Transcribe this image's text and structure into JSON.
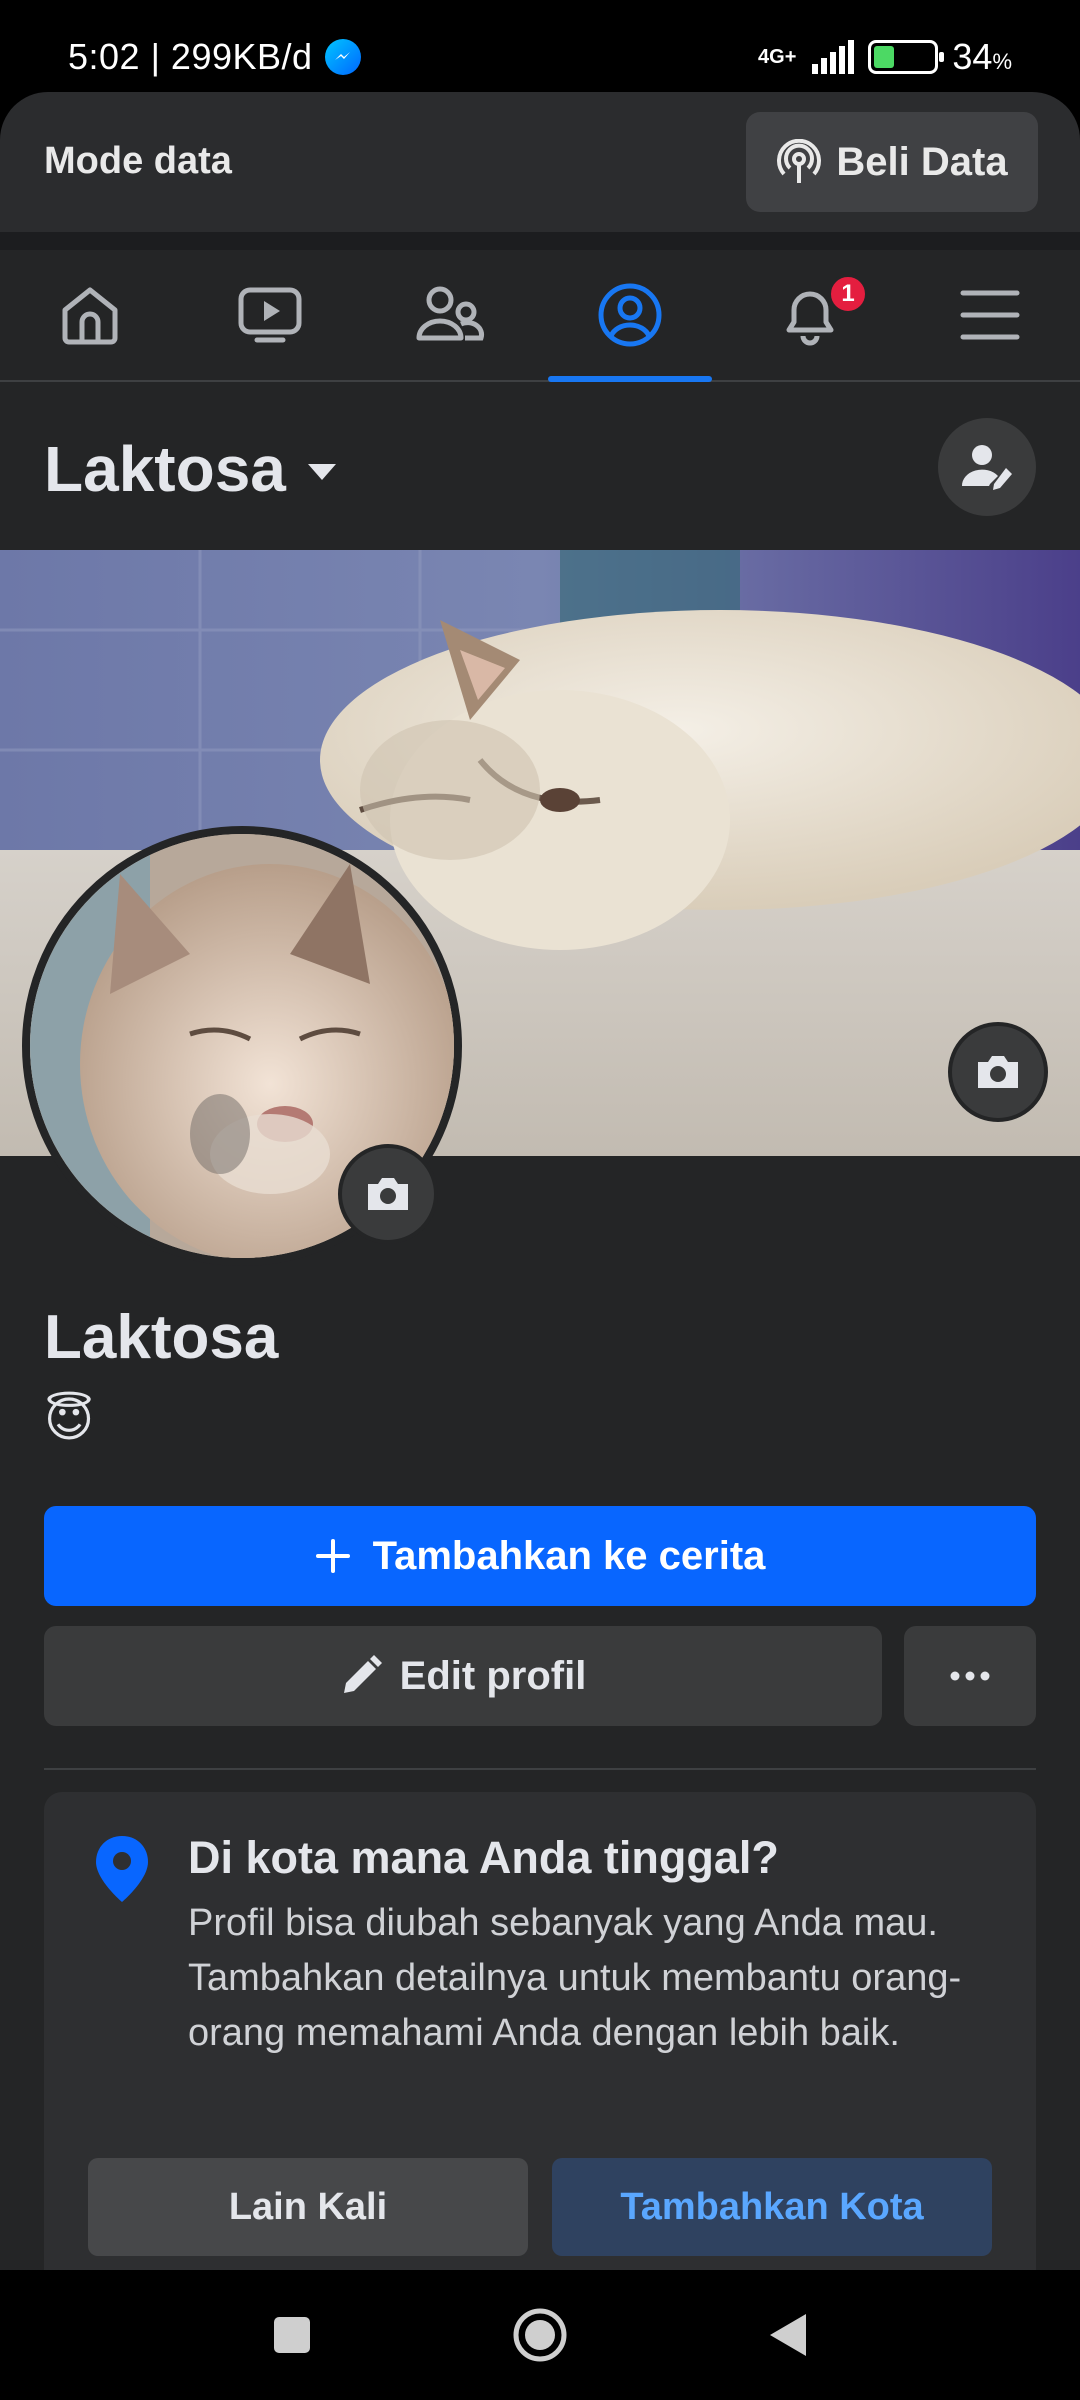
{
  "status_bar": {
    "time_speed": "5:02 | 299KB/d",
    "network": "4G+",
    "battery": "34",
    "battery_unit": "%",
    "battery_level": 0.34
  },
  "mode_bar": {
    "label": "Mode data",
    "buy_button": "Beli Data"
  },
  "nav": {
    "items": [
      {
        "icon": "home-icon"
      },
      {
        "icon": "video-icon"
      },
      {
        "icon": "friends-icon"
      },
      {
        "icon": "profile-icon",
        "active": true
      },
      {
        "icon": "bell-icon",
        "badge": "1"
      },
      {
        "icon": "menu-icon"
      }
    ],
    "active_color": "#1877f2"
  },
  "header": {
    "name": "Laktosa"
  },
  "profile": {
    "name": "Laktosa",
    "emoji": "😇"
  },
  "actions": {
    "story_label": "Tambahkan ke cerita",
    "edit_label": "Edit profil",
    "more_label": "•••"
  },
  "city_prompt": {
    "title": "Di kota mana Anda tinggal?",
    "description": "Profil bisa diubah sebanyak yang Anda mau. Tambahkan detailnya untuk membantu orang-orang memahami Anda dengan lebih baik.",
    "later_label": "Lain Kali",
    "add_label": "Tambahkan Kota"
  },
  "colors": {
    "accent": "#0866ff",
    "background": "#242526",
    "badge": "#e41e3f"
  }
}
